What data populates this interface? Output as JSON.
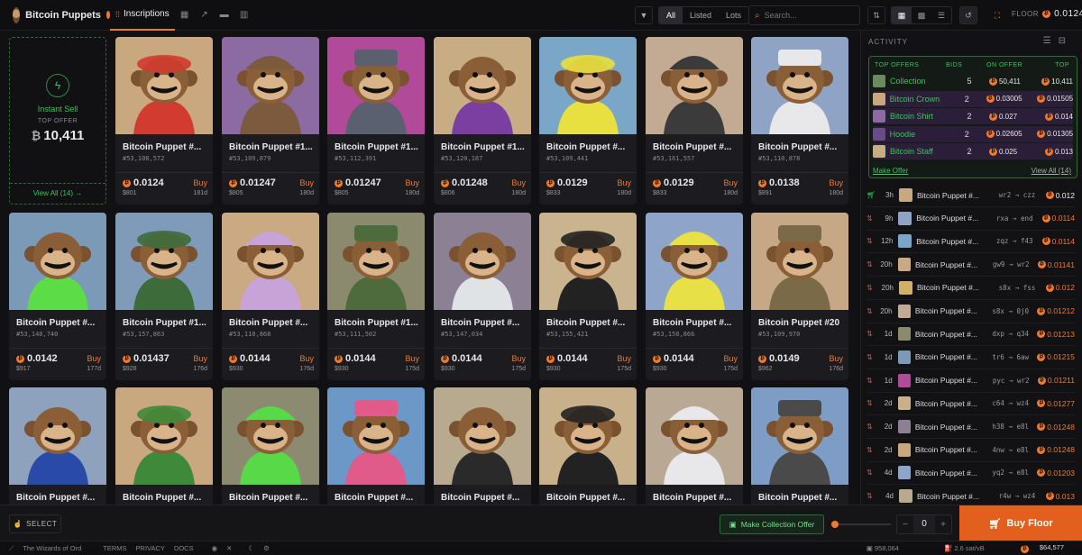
{
  "header": {
    "collection_name": "Bitcoin Puppets",
    "tab_active": "Inscriptions",
    "filters": [
      "All",
      "Listed",
      "Lots"
    ],
    "search_placeholder": "Search...",
    "floor_label": "FLOOR",
    "floor_value": "0.0124"
  },
  "instant_sell": {
    "label": "Instant Sell",
    "top_offer_label": "TOP OFFER",
    "top_offer_value": "10,411",
    "currency_symbol": "₿",
    "view_all": "View All (14) →"
  },
  "cards": [
    {
      "name": "Bitcoin Puppet #...",
      "num": "#53,108,572",
      "price": "0.0124",
      "usd": "$801",
      "age": "181d",
      "bg": "#c9a77f",
      "acc": "#d23b2f"
    },
    {
      "name": "Bitcoin Puppet #1...",
      "num": "#53,109,879",
      "price": "0.01247",
      "usd": "$805",
      "age": "180d",
      "bg": "#8c6ba3",
      "acc": "#7b5a3e"
    },
    {
      "name": "Bitcoin Puppet #1...",
      "num": "#53,112,391",
      "price": "0.01247",
      "usd": "$805",
      "age": "180d",
      "bg": "#b24a9a",
      "acc": "#5b6070"
    },
    {
      "name": "Bitcoin Puppet #1...",
      "num": "#53,120,187",
      "price": "0.01248",
      "usd": "$806",
      "age": "180d",
      "bg": "#c8ac84",
      "acc": "#7a3fa0"
    },
    {
      "name": "Bitcoin Puppet #...",
      "num": "#53,109,441",
      "price": "0.0129",
      "usd": "$833",
      "age": "180d",
      "bg": "#7aa6c7",
      "acc": "#e8e040"
    },
    {
      "name": "Bitcoin Puppet #...",
      "num": "#53,161,557",
      "price": "0.0129",
      "usd": "$833",
      "age": "180d",
      "bg": "#c2ab92",
      "acc": "#3b3b3b"
    },
    {
      "name": "Bitcoin Puppet #...",
      "num": "#53,110,878",
      "price": "0.0138",
      "usd": "$891",
      "age": "180d",
      "bg": "#8fa4c4",
      "acc": "#e8e8ea"
    },
    {
      "name": "Bitcoin Puppet #...",
      "num": "#53,140,740",
      "price": "0.0142",
      "usd": "$917",
      "age": "177d",
      "bg": "#7a9ab8",
      "acc": "#5cdc46"
    },
    {
      "name": "Bitcoin Puppet #1...",
      "num": "#53,157,863",
      "price": "0.01437",
      "usd": "$928",
      "age": "176d",
      "bg": "#7f9bb9",
      "acc": "#3e6b3a"
    },
    {
      "name": "Bitcoin Puppet #...",
      "num": "#53,110,868",
      "price": "0.0144",
      "usd": "$930",
      "age": "176d",
      "bg": "#c9aa82",
      "acc": "#c7a3d8"
    },
    {
      "name": "Bitcoin Puppet #1...",
      "num": "#53,111,502",
      "price": "0.0144",
      "usd": "$930",
      "age": "175d",
      "bg": "#8c8a6e",
      "acc": "#4e6b3e"
    },
    {
      "name": "Bitcoin Puppet #...",
      "num": "#53,147,034",
      "price": "0.0144",
      "usd": "$930",
      "age": "175d",
      "bg": "#8c8094",
      "acc": "#dfe3e6"
    },
    {
      "name": "Bitcoin Puppet #...",
      "num": "#53,155,421",
      "price": "0.0144",
      "usd": "$930",
      "age": "175d",
      "bg": "#c9b48f",
      "acc": "#222222"
    },
    {
      "name": "Bitcoin Puppet #...",
      "num": "#53,158,866",
      "price": "0.0144",
      "usd": "$930",
      "age": "175d",
      "bg": "#8ea4c8",
      "acc": "#e7e046"
    },
    {
      "name": "Bitcoin Puppet #20",
      "num": "#53,109,970",
      "price": "0.0149",
      "usd": "$962",
      "age": "176d",
      "bg": "#c6a886",
      "acc": "#7a6a48"
    },
    {
      "name": "Bitcoin Puppet #...",
      "num": "",
      "price": "",
      "usd": "",
      "age": "",
      "bg": "#8fa2bd",
      "acc": "#2a4aa8"
    },
    {
      "name": "Bitcoin Puppet #...",
      "num": "",
      "price": "",
      "usd": "",
      "age": "",
      "bg": "#c9a880",
      "acc": "#3f8a3a"
    },
    {
      "name": "Bitcoin Puppet #...",
      "num": "",
      "price": "",
      "usd": "",
      "age": "",
      "bg": "#8c8a70",
      "acc": "#58d948"
    },
    {
      "name": "Bitcoin Puppet #...",
      "num": "",
      "price": "",
      "usd": "",
      "age": "",
      "bg": "#6c98c8",
      "acc": "#e05a8a"
    },
    {
      "name": "Bitcoin Puppet #...",
      "num": "",
      "price": "",
      "usd": "",
      "age": "",
      "bg": "#b7aa8f",
      "acc": "#2a2a2a"
    },
    {
      "name": "Bitcoin Puppet #...",
      "num": "",
      "price": "",
      "usd": "",
      "age": "",
      "bg": "#c8b08a",
      "acc": "#222222"
    },
    {
      "name": "Bitcoin Puppet #...",
      "num": "",
      "price": "",
      "usd": "",
      "age": "",
      "bg": "#b8a894",
      "acc": "#e8e8ea"
    },
    {
      "name": "Bitcoin Puppet #...",
      "num": "",
      "price": "",
      "usd": "",
      "age": "",
      "bg": "#7d9cc6",
      "acc": "#4a4a4a"
    }
  ],
  "buy_label": "Buy",
  "activity": {
    "title": "ACTIVITY",
    "offers_header": [
      "TOP OFFERS",
      "BIDS",
      "ON OFFER",
      "TOP"
    ],
    "offers": [
      {
        "label": "Collection",
        "bids": "5",
        "on_offer": "50,411",
        "top": "10,411",
        "cur": "₿",
        "thumb": "#6b8a5e"
      },
      {
        "label": "Bitcoin Crown",
        "bids": "2",
        "on_offer": "0.03005",
        "top": "0.01505",
        "cur": "₿",
        "thumb": "#c9a77f"
      },
      {
        "label": "Bitcoin Shirt",
        "bids": "2",
        "on_offer": "0.027",
        "top": "0.014",
        "cur": "₿",
        "thumb": "#8c6ba3"
      },
      {
        "label": "Hoodie",
        "bids": "2",
        "on_offer": "0.02605",
        "top": "0.01305",
        "cur": "₿",
        "thumb": "#6b4a8a"
      },
      {
        "label": "Bitcoin Staff",
        "bids": "2",
        "on_offer": "0.025",
        "top": "0.013",
        "cur": "₿",
        "thumb": "#c8ac84"
      }
    ],
    "make_offer": "Make Offer",
    "view_all": "View All (14)",
    "rows": [
      {
        "time": "3h",
        "name": "Bitcoin Puppet #...",
        "from": "wr2 → czz",
        "price": "0.012",
        "thumb": "#c9a77f",
        "buy": true
      },
      {
        "time": "9h",
        "name": "Bitcoin Puppet #...",
        "from": "rxa → end",
        "price": "0.0114",
        "thumb": "#8fa4c4",
        "buy": false
      },
      {
        "time": "12h",
        "name": "Bitcoin Puppet #...",
        "from": "zqz → f43",
        "price": "0.0114",
        "thumb": "#7aa6c7",
        "buy": false
      },
      {
        "time": "20h",
        "name": "Bitcoin Puppet #...",
        "from": "gw9 → wr2",
        "price": "0.01141",
        "thumb": "#c9aa82",
        "buy": false
      },
      {
        "time": "20h",
        "name": "Bitcoin Puppet #...",
        "from": "s8x → fss",
        "price": "0.012",
        "thumb": "#d2b068",
        "buy": false
      },
      {
        "time": "20h",
        "name": "Bitcoin Puppet #...",
        "from": "s8x → 0j0",
        "price": "0.01212",
        "thumb": "#c2ab92",
        "buy": false
      },
      {
        "time": "1d",
        "name": "Bitcoin Puppet #...",
        "from": "dxp → q34",
        "price": "0.01213",
        "thumb": "#8c8a6e",
        "buy": false
      },
      {
        "time": "1d",
        "name": "Bitcoin Puppet #...",
        "from": "tr6 → 6aw",
        "price": "0.01215",
        "thumb": "#7a9ab8",
        "buy": false
      },
      {
        "time": "1d",
        "name": "Bitcoin Puppet #...",
        "from": "pyc → wr2",
        "price": "0.01211",
        "thumb": "#b24a9a",
        "buy": false
      },
      {
        "time": "2d",
        "name": "Bitcoin Puppet #...",
        "from": "c64 → wz4",
        "price": "0.01277",
        "thumb": "#c8b08a",
        "buy": false
      },
      {
        "time": "2d",
        "name": "Bitcoin Puppet #...",
        "from": "h38 → e8l",
        "price": "0.01248",
        "thumb": "#8c8094",
        "buy": false
      },
      {
        "time": "2d",
        "name": "Bitcoin Puppet #...",
        "from": "4nw → e8l",
        "price": "0.01248",
        "thumb": "#c9a880",
        "buy": false
      },
      {
        "time": "4d",
        "name": "Bitcoin Puppet #...",
        "from": "yq2 → e8l",
        "price": "0.01203",
        "thumb": "#8ea4c8",
        "buy": false
      },
      {
        "time": "4d",
        "name": "Bitcoin Puppet #...",
        "from": "r4w → wz4",
        "price": "0.013",
        "thumb": "#b7aa8f",
        "buy": false
      }
    ]
  },
  "bottom": {
    "select": "SELECT",
    "make_collection_offer": "Make Collection Offer",
    "quantity": "0",
    "buy_floor": "Buy Floor"
  },
  "footer": {
    "brand": "The Wizards of Ord",
    "links": [
      "TERMS",
      "PRIVACY",
      "DOCS"
    ],
    "block": "958,064",
    "fee": "2.6 sat/vB",
    "btc_price": "$64,577"
  }
}
